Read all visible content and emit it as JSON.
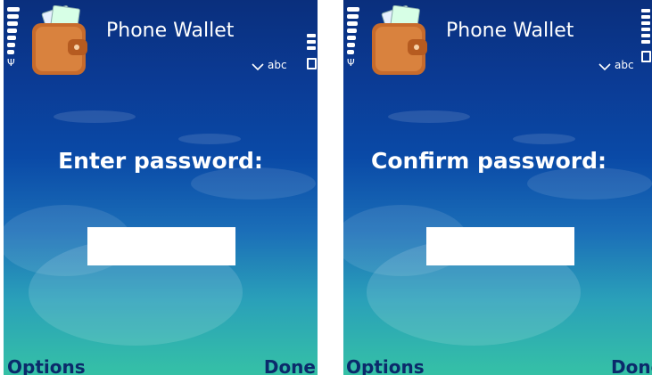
{
  "screens": [
    {
      "app_title": "Phone Wallet",
      "input_mode": "abc",
      "prompt": "Enter password:",
      "password_value": "",
      "softkeys": {
        "left": "Options",
        "right": "Done"
      }
    },
    {
      "app_title": "Phone Wallet",
      "input_mode": "abc",
      "prompt": "Confirm password:",
      "password_value": "",
      "softkeys": {
        "left": "Options",
        "right": "Done"
      }
    }
  ],
  "icons": [
    "wallet-icon",
    "signal-strength-icon",
    "battery-icon",
    "message-mode-icon"
  ],
  "colors": {
    "background_top": "#0a2f7d",
    "background_bottom": "#35c1a6",
    "softkey_text": "#0b2a6b",
    "text": "#ffffff"
  }
}
